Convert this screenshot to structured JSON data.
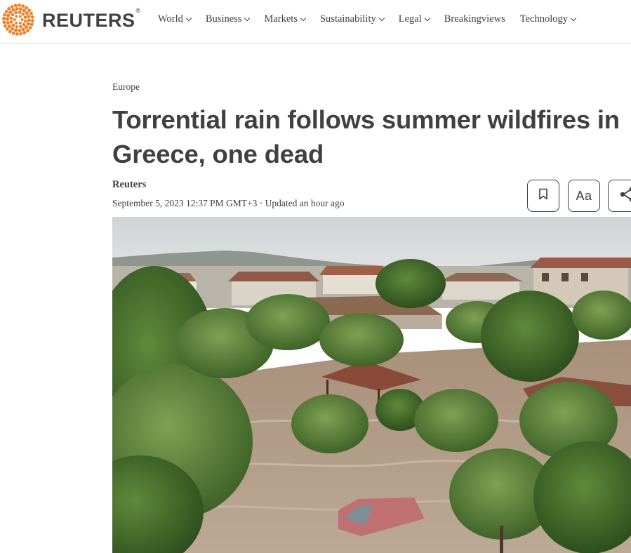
{
  "header": {
    "logo_text": "REUTERS",
    "logo_mark": "®",
    "nav": [
      {
        "label": "World",
        "has_dropdown": true
      },
      {
        "label": "Business",
        "has_dropdown": true
      },
      {
        "label": "Markets",
        "has_dropdown": true
      },
      {
        "label": "Sustainability",
        "has_dropdown": true
      },
      {
        "label": "Legal",
        "has_dropdown": true
      },
      {
        "label": "Breakingviews",
        "has_dropdown": false
      },
      {
        "label": "Technology",
        "has_dropdown": true
      }
    ]
  },
  "article": {
    "section": "Europe",
    "headline": "Torrential rain follows summer wildfires in Greece, one dead",
    "byline": "Reuters",
    "dateline": "September 5, 2023 12:37 PM GMT+3 · Updated an hour ago"
  },
  "toolbar": {
    "font_label": "Aa",
    "icons": [
      "bookmark-icon",
      "font-size-icon",
      "share-icon"
    ]
  },
  "colors": {
    "text": "#404040",
    "logo_orange": "#f07f22",
    "divider": "#d6d6d6"
  }
}
